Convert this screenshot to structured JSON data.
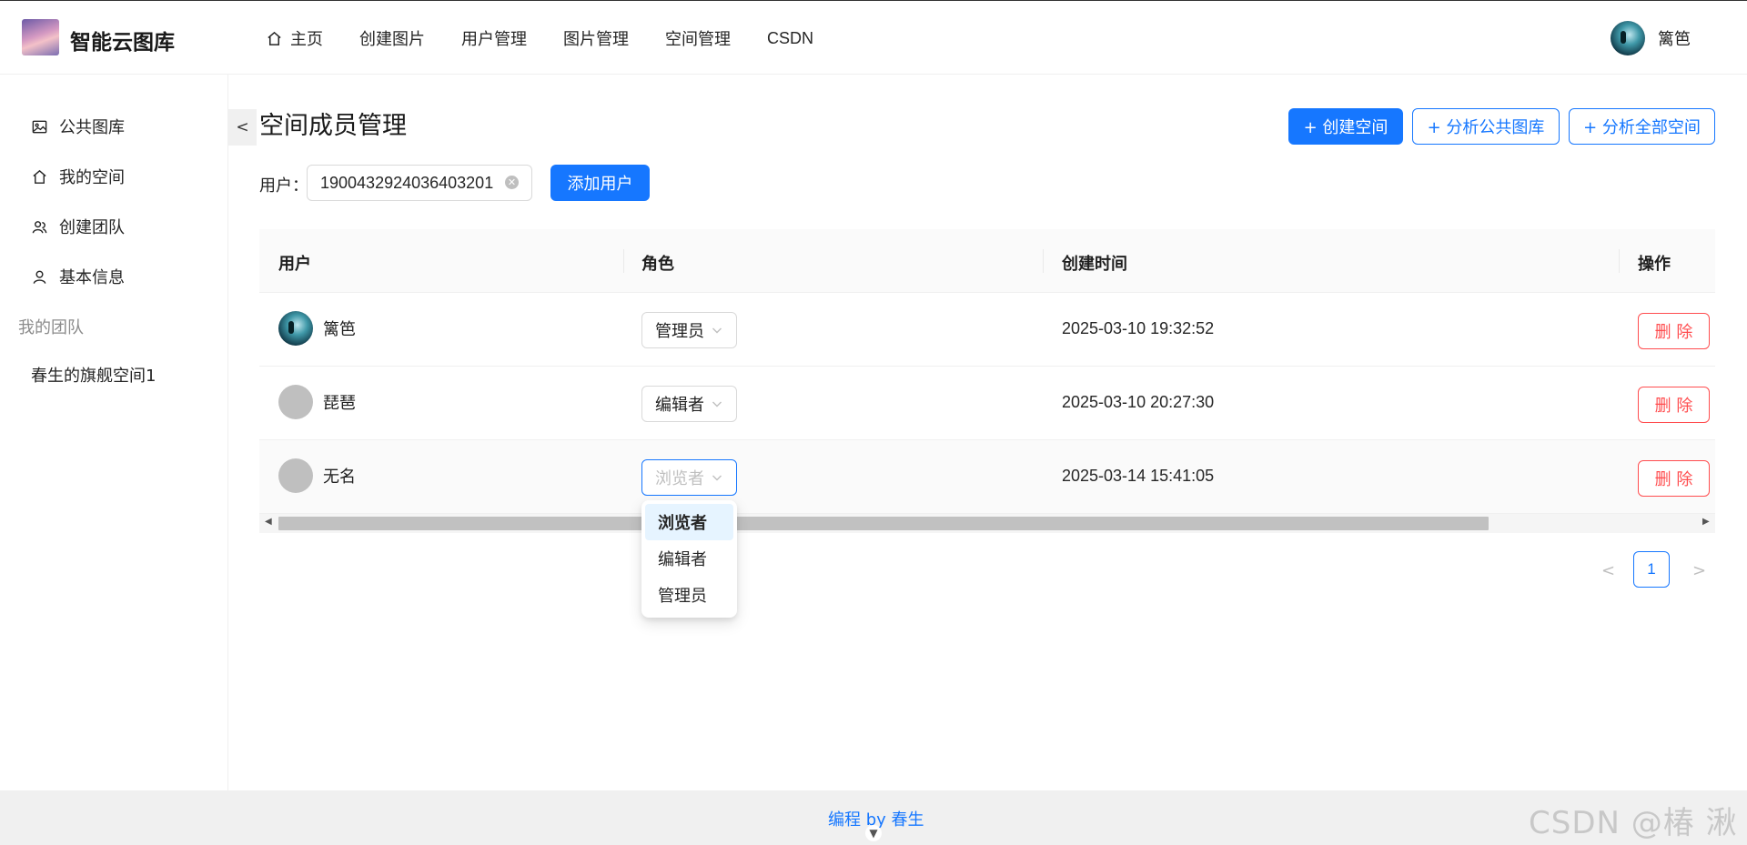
{
  "header": {
    "app_title": "智能云图库",
    "nav": [
      {
        "label": "主页",
        "icon": "home-icon"
      },
      {
        "label": "创建图片"
      },
      {
        "label": "用户管理"
      },
      {
        "label": "图片管理"
      },
      {
        "label": "空间管理"
      },
      {
        "label": "CSDN"
      }
    ],
    "user_name": "篱笆"
  },
  "sidebar": {
    "items": [
      {
        "label": "公共图库",
        "icon": "image-icon"
      },
      {
        "label": "我的空间",
        "icon": "home-icon"
      },
      {
        "label": "创建团队",
        "icon": "team-icon"
      },
      {
        "label": "基本信息",
        "icon": "user-icon"
      }
    ],
    "group_title": "我的团队",
    "team_items": [
      "春生的旗舰空间1"
    ],
    "collapse_label": "<"
  },
  "main": {
    "title": "空间成员管理",
    "buttons": {
      "create_space": "+ 创建空间",
      "analyze_public": "+ 分析公共图库",
      "analyze_all": "+ 分析全部空间"
    },
    "search": {
      "label": "用户：",
      "value": "1900432924036403201",
      "add_button": "添加用户"
    },
    "table": {
      "columns": [
        "用户",
        "角色",
        "创建时间",
        "操作"
      ],
      "rows": [
        {
          "user": "篱笆",
          "role": "管理员",
          "time": "2025-03-10 19:32:52",
          "action": "删 除"
        },
        {
          "user": "琵琶",
          "role": "编辑者",
          "time": "2025-03-10 20:27:30",
          "action": "删 除"
        },
        {
          "user": "无名",
          "role": "浏览者",
          "time": "2025-03-14 15:41:05",
          "action": "删 除"
        }
      ]
    },
    "dropdown_options": [
      "浏览者",
      "编辑者",
      "管理员"
    ],
    "pagination": {
      "current": "1",
      "prev": "<",
      "next": ">"
    }
  },
  "footer": {
    "text": "编程 by 春生"
  },
  "watermark": "CSDN @椿  湫",
  "colors": {
    "primary": "#1677ff",
    "danger": "#ff4d4f"
  }
}
